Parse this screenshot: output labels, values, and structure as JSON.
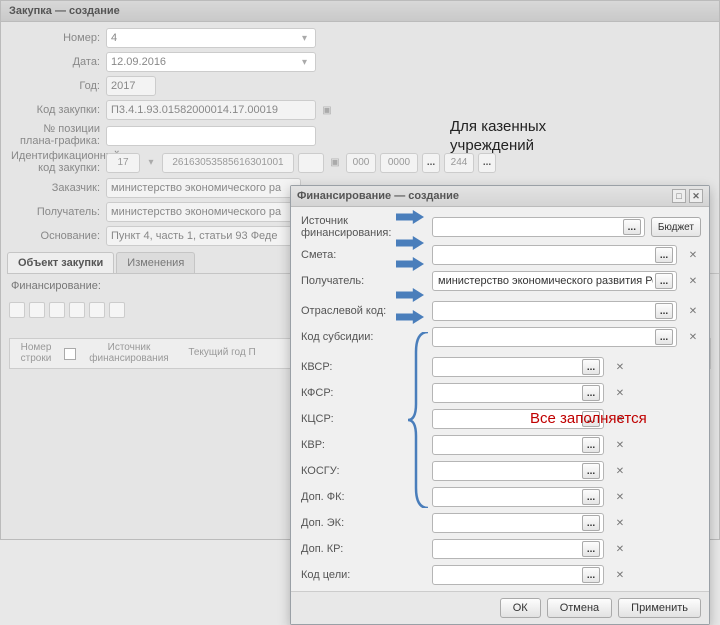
{
  "main": {
    "title": "Закупка — создание",
    "fields": {
      "number_label": "Номер:",
      "number_value": "4",
      "date_label": "Дата:",
      "date_value": "12.09.2016",
      "year_label": "Год:",
      "year_value": "2017",
      "code_label": "Код закупки:",
      "code_value": "П3.4.1.93.01582000014.17.00019",
      "plan_pos_label": "№ позиции плана-графика:",
      "id_label": "Идентификационный код закупки:",
      "id_seg1": "17",
      "id_seg2": "2616305358561630​1001",
      "id_seg3": "",
      "id_seg4": "000",
      "id_seg5": "0000",
      "id_btn": "...",
      "id_seg6": "244",
      "customer_label": "Заказчик:",
      "customer_value": "министерство экономического ра",
      "recipient_label": "Получатель:",
      "recipient_value": "министерство экономического ра",
      "basis_label": "Основание:",
      "basis_value": "Пункт 4, часть 1, статьи 93 Феде"
    },
    "tabs": {
      "object": "Объект закупки",
      "changes": "Изменения"
    },
    "financing_label": "Финансирование:",
    "table": {
      "col_row": "Номер строки",
      "col_source": "Источник финансирования",
      "col_year": "Текущий год  П"
    }
  },
  "modal": {
    "title": "Финансирование — создание",
    "rows": {
      "source": "Источник финансирования:",
      "smeta": "Смета:",
      "recipient": "Получатель:",
      "recipient_value": "министерство экономического развития Ростовской области",
      "branch_code": "Отраслевой код:",
      "subsidy_code": "Код субсидии:",
      "kvsr": "КВСР:",
      "kfsr": "КФСР:",
      "kcsr": "КЦСР:",
      "kvr": "КВР:",
      "kosgu": "КОСГУ:",
      "dop_fk": "Доп. ФК:",
      "dop_ek": "Доп. ЭК:",
      "dop_kr": "Доп. КР:",
      "goal_code": "Код цели:"
    },
    "budget_btn": "Бюджет",
    "dots": "...",
    "footer": {
      "ok": "ОК",
      "cancel": "Отмена",
      "apply": "Применить"
    }
  },
  "annotations": {
    "top_note": "Для казенных учреждений",
    "fill_note": "Все заполняется"
  }
}
